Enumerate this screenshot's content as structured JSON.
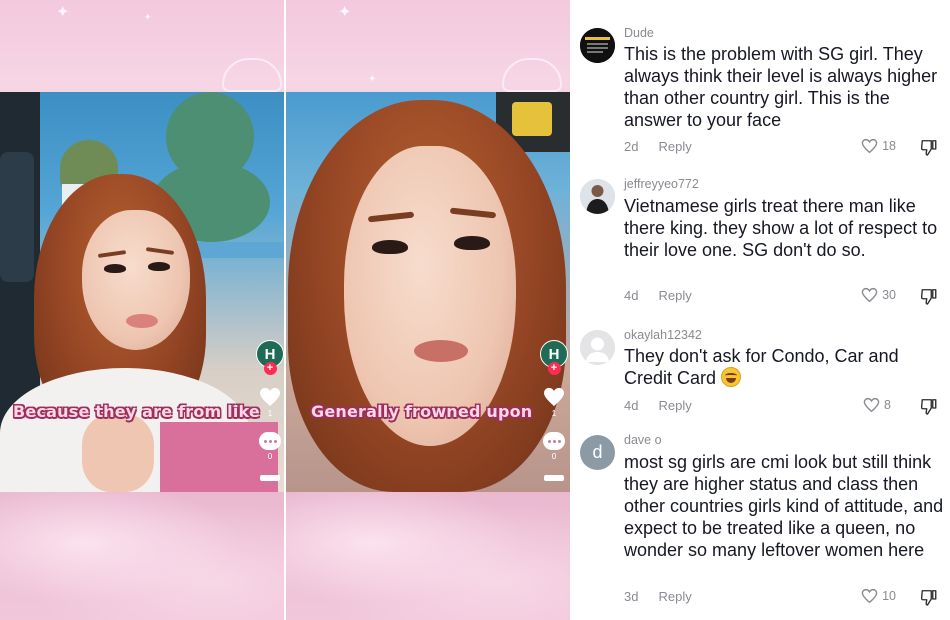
{
  "video_left": {
    "caption": "Because they are from like",
    "creator_initial": "H",
    "follow_symbol": "+",
    "like_count": "1",
    "comment_count": "0"
  },
  "video_right": {
    "caption": "Generally frowned upon",
    "creator_initial": "H",
    "follow_symbol": "+",
    "like_count": "1",
    "comment_count": "0"
  },
  "comments": [
    {
      "username": "Dude",
      "text": "This is the problem with SG girl. They always think their level is always higher than other country girl. This is the answer to your face",
      "age": "2d",
      "reply_label": "Reply",
      "likes": "18",
      "avatar_icon": "book-cover-avatar"
    },
    {
      "username": "jeffreyyeo772",
      "text": "Vietnamese girls treat there man like there king. they show a lot of respect to their love one. SG don't do so.",
      "age": "4d",
      "reply_label": "Reply",
      "likes": "30",
      "avatar_icon": "photo-avatar"
    },
    {
      "username": "okaylah12342",
      "text": "They don't ask for Condo, Car and Credit Card",
      "age": "4d",
      "reply_label": "Reply",
      "likes": "8",
      "avatar_icon": "default-person-avatar",
      "emoji": "rolling-on-floor-laughing"
    },
    {
      "username": "dave o",
      "text": "most sg girls are cmi look but still think they are higher status and class then other countries girls kind of attitude, and expect to be treated like a queen, no wonder so many leftover women here",
      "age": "3d",
      "reply_label": "Reply",
      "likes": "10",
      "avatar_initial": "d",
      "avatar_color": "#8c9aa6"
    }
  ]
}
